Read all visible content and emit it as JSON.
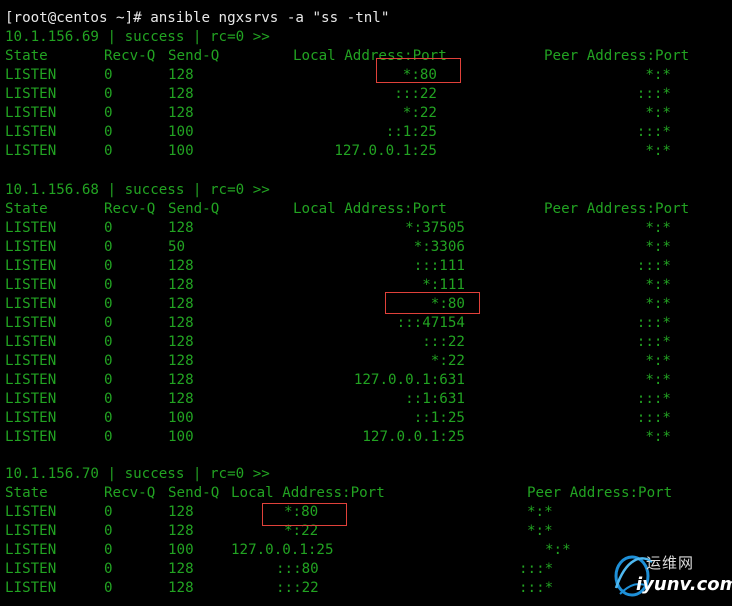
{
  "terminal": {
    "command_line": "[root@centos ~]# ansible ngxsrvs -a \"ss -tnl\"",
    "text_color": "#22a322",
    "background": "#000000",
    "highlight_color": "#e0413a"
  },
  "hosts": [
    {
      "header": "10.1.156.69 | success | rc=0 >>",
      "columns": {
        "state": "State",
        "recvq": "Recv-Q",
        "sendq": "Send-Q",
        "local": "Local Address:Port",
        "peer": "Peer Address:Port"
      },
      "rows": [
        {
          "state": "LISTEN",
          "recvq": "0",
          "sendq": "128",
          "local": "*:80",
          "peer": "*:*",
          "highlighted": true
        },
        {
          "state": "LISTEN",
          "recvq": "0",
          "sendq": "128",
          "local": ":::22",
          "peer": ":::*"
        },
        {
          "state": "LISTEN",
          "recvq": "0",
          "sendq": "128",
          "local": "*:22",
          "peer": "*:*"
        },
        {
          "state": "LISTEN",
          "recvq": "0",
          "sendq": "100",
          "local": "::1:25",
          "peer": ":::*"
        },
        {
          "state": "LISTEN",
          "recvq": "0",
          "sendq": "100",
          "local": "127.0.0.1:25",
          "peer": "*:*"
        }
      ]
    },
    {
      "header": "10.1.156.68 | success | rc=0 >>",
      "columns": {
        "state": "State",
        "recvq": "Recv-Q",
        "sendq": "Send-Q",
        "local": "Local Address:Port",
        "peer": "Peer Address:Port"
      },
      "rows": [
        {
          "state": "LISTEN",
          "recvq": "0",
          "sendq": "128",
          "local": "*:37505",
          "peer": "*:*"
        },
        {
          "state": "LISTEN",
          "recvq": "0",
          "sendq": "50",
          "local": "*:3306",
          "peer": "*:*"
        },
        {
          "state": "LISTEN",
          "recvq": "0",
          "sendq": "128",
          "local": ":::111",
          "peer": ":::*"
        },
        {
          "state": "LISTEN",
          "recvq": "0",
          "sendq": "128",
          "local": "*:111",
          "peer": "*:*"
        },
        {
          "state": "LISTEN",
          "recvq": "0",
          "sendq": "128",
          "local": "*:80",
          "peer": "*:*",
          "highlighted": true
        },
        {
          "state": "LISTEN",
          "recvq": "0",
          "sendq": "128",
          "local": ":::47154",
          "peer": ":::*"
        },
        {
          "state": "LISTEN",
          "recvq": "0",
          "sendq": "128",
          "local": ":::22",
          "peer": ":::*"
        },
        {
          "state": "LISTEN",
          "recvq": "0",
          "sendq": "128",
          "local": "*:22",
          "peer": "*:*"
        },
        {
          "state": "LISTEN",
          "recvq": "0",
          "sendq": "128",
          "local": "127.0.0.1:631",
          "peer": "*:*"
        },
        {
          "state": "LISTEN",
          "recvq": "0",
          "sendq": "128",
          "local": "::1:631",
          "peer": ":::*"
        },
        {
          "state": "LISTEN",
          "recvq": "0",
          "sendq": "100",
          "local": "::1:25",
          "peer": ":::*"
        },
        {
          "state": "LISTEN",
          "recvq": "0",
          "sendq": "100",
          "local": "127.0.0.1:25",
          "peer": "*:*"
        }
      ]
    },
    {
      "header": "10.1.156.70 | success | rc=0 >>",
      "columns": {
        "state": "State",
        "recvq": "Recv-Q",
        "sendq": "Send-Q",
        "local": "Local Address:Port",
        "peer": "Peer Address:Port"
      },
      "rows": [
        {
          "state": "LISTEN",
          "recvq": "0",
          "sendq": "128",
          "local": "*:80",
          "peer": "*:*",
          "highlighted": true
        },
        {
          "state": "LISTEN",
          "recvq": "0",
          "sendq": "128",
          "local": "*:22",
          "peer": "*:*"
        },
        {
          "state": "LISTEN",
          "recvq": "0",
          "sendq": "100",
          "local": "127.0.0.1:25",
          "peer": "*:*"
        },
        {
          "state": "LISTEN",
          "recvq": "0",
          "sendq": "128",
          "local": ":::80",
          "peer": ":::*"
        },
        {
          "state": "LISTEN",
          "recvq": "0",
          "sendq": "128",
          "local": ":::22",
          "peer": ":::*"
        }
      ]
    }
  ],
  "watermark": {
    "icon": "globe-swoosh-icon",
    "chinese": "运维网",
    "url": "iyunv.com"
  }
}
